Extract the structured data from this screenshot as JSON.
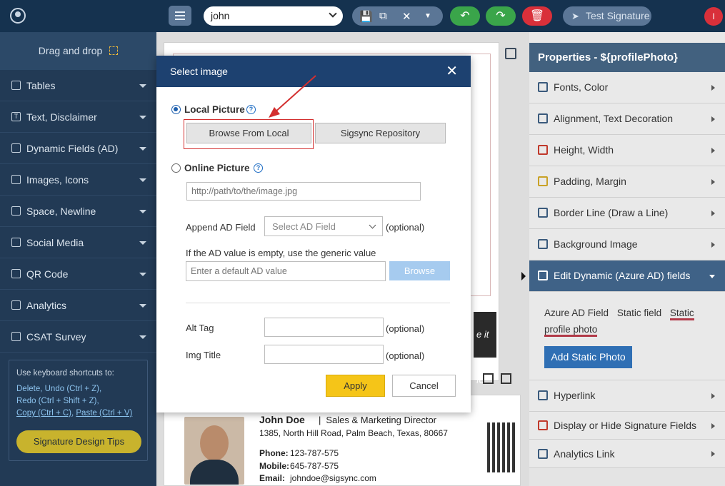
{
  "topbar": {
    "profile_select": "john",
    "test_signature": "Test Signature",
    "user_initial": "I",
    "icons": [
      "save-icon",
      "copy-icon",
      "close-icon",
      "caret-down-icon",
      "undo-icon",
      "redo-icon",
      "trash-icon",
      "paper-plane-icon"
    ],
    "colors": {
      "undo": "#3aa54a",
      "redo": "#3aa54a",
      "delete": "#d9303a"
    }
  },
  "sidebar": {
    "drag_drop": "Drag and drop",
    "items": [
      {
        "label": "Tables",
        "icon": "table-icon"
      },
      {
        "label": "Text, Disclaimer",
        "icon": "text-icon"
      },
      {
        "label": "Dynamic Fields (AD)",
        "icon": "code-icon"
      },
      {
        "label": "Images, Icons",
        "icon": "image-icon"
      },
      {
        "label": "Space, Newline",
        "icon": "newline-icon"
      },
      {
        "label": "Social Media",
        "icon": "instagram-icon"
      },
      {
        "label": "QR Code",
        "icon": "qr-icon"
      },
      {
        "label": "Analytics",
        "icon": "analytics-icon"
      },
      {
        "label": "CSAT Survey",
        "icon": "survey-icon"
      }
    ],
    "shortcuts": {
      "intro": "Use keyboard shortcuts to:",
      "line1": "Delete, Undo (Ctrl + Z),",
      "line2": "Redo (Ctrl + Shift + Z),",
      "line3a": "Copy (Ctrl + C)",
      "line3sep": ", ",
      "line3b": "Paste (Ctrl + V)"
    },
    "tips_button": "Signature Design Tips"
  },
  "canvas": {
    "dark_text": "e it fo",
    "signature": {
      "name": "John Doe",
      "separator": "|",
      "title": "Sales & Marketing Director",
      "address": "1385, North Hill Road, Palm Beach, Texas, 80667",
      "phone_label": "Phone:",
      "phone": "123-787-575",
      "mobile_label": "Mobile:",
      "mobile": "645-787-575",
      "email_label": "Email:",
      "email": "johndoe@sigsync.com"
    }
  },
  "properties": {
    "title": "Properties - ${profilePhoto}",
    "items": [
      {
        "label": "Fonts, Color",
        "icon": "font-icon"
      },
      {
        "label": "Alignment, Text Decoration",
        "icon": "align-icon"
      },
      {
        "label": "Height, Width",
        "icon": "height-icon"
      },
      {
        "label": "Padding, Margin",
        "icon": "padding-icon"
      },
      {
        "label": "Border Line (Draw a Line)",
        "icon": "border-icon"
      },
      {
        "label": "Background Image",
        "icon": "background-image-icon"
      }
    ],
    "active_item": {
      "label": "Edit Dynamic (Azure AD) fields",
      "icon": "azure-icon"
    },
    "tabs": [
      "Azure AD Field",
      "Static field",
      "Static profile photo"
    ],
    "add_static_photo": "Add Static Photo",
    "bottom_items": [
      {
        "label": "Hyperlink",
        "icon": "link-icon"
      },
      {
        "label": "Display or Hide Signature Fields",
        "icon": "eye-icon"
      },
      {
        "label": "Analytics Link",
        "icon": "chart-icon"
      }
    ]
  },
  "modal": {
    "title": "Select image",
    "local_picture": "Local Picture",
    "browse_local": "Browse From Local",
    "sigsync_repo": "Sigsync Repository",
    "online_picture": "Online Picture",
    "url_placeholder": "http://path/to/the/image.jpg",
    "append_ad_label": "Append AD Field",
    "append_ad_select": "Select AD Field",
    "optional": "(optional)",
    "empty_ad_hint": "If the AD value is empty, use the generic value",
    "default_ad_placeholder": "Enter a default AD value",
    "browse": "Browse",
    "alt_tag": "Alt Tag",
    "img_title": "Img Title",
    "apply": "Apply",
    "cancel": "Cancel",
    "selected_option": "Local Picture"
  }
}
